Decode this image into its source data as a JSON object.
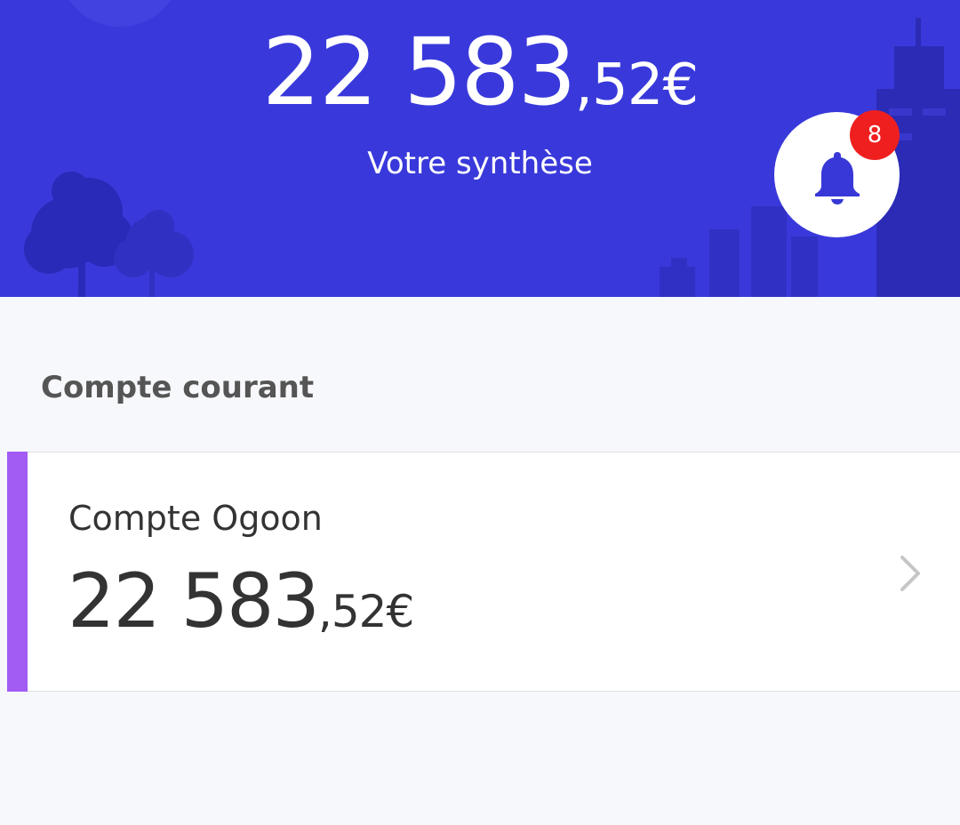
{
  "summary": {
    "balance_int": "22 583",
    "balance_dec": ",52€",
    "label": "Votre synthèse"
  },
  "notifications": {
    "icon": "bell-icon",
    "count": "8"
  },
  "section": {
    "title": "Compte courant"
  },
  "account": {
    "name": "Compte Ogoon",
    "balance_int": "22 583",
    "balance_dec": ",52€",
    "accent_color": "#a25cf3"
  },
  "colors": {
    "header_bg": "#3939db",
    "badge": "#ef1f1f",
    "page_bg": "#f7f8fb"
  }
}
